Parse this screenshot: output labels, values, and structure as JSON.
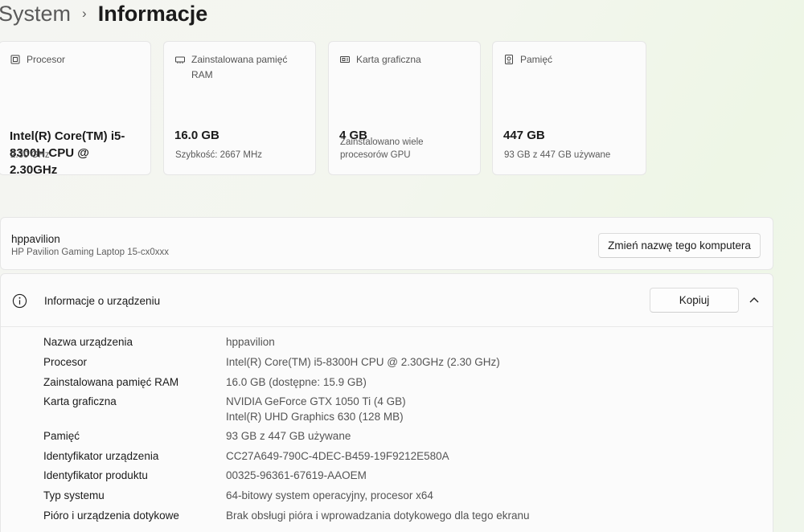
{
  "breadcrumb": {
    "parent": "System",
    "separator": "›",
    "current": "Informacje"
  },
  "cards": [
    {
      "label": "Procesor",
      "value": "Intel(R) Core(TM) i5-8300H CPU @ 2.30GHz",
      "sub": "2.30 GHz",
      "icon": "processor-icon"
    },
    {
      "label": "Zainstalowana pamięć RAM",
      "value": "16.0 GB",
      "sub": "Szybkość: 2667 MHz",
      "icon": "ram-icon"
    },
    {
      "label": "Karta graficzna",
      "value": "4 GB",
      "sub": "Zainstalowano wiele procesorów GPU",
      "icon": "graphics-card-icon"
    },
    {
      "label": "Pamięć",
      "value": "447 GB",
      "sub": "93 GB z 447 GB używane",
      "icon": "storage-icon"
    }
  ],
  "device": {
    "name": "hppavilion",
    "model": "HP Pavilion Gaming Laptop 15-cx0xxx",
    "rename_label": "Zmień nazwę tego komputera"
  },
  "info": {
    "title": "Informacje o urządzeniu",
    "copy_label": "Kopiuj",
    "specs": [
      {
        "key": "Nazwa urządzenia",
        "value": "hppavilion"
      },
      {
        "key": "Procesor",
        "value": "Intel(R) Core(TM) i5-8300H CPU @ 2.30GHz (2.30 GHz)"
      },
      {
        "key": "Zainstalowana pamięć RAM",
        "value": "16.0 GB (dostępne: 15.9 GB)"
      },
      {
        "key": "Karta graficzna",
        "value": "NVIDIA GeForce GTX 1050 Ti (4 GB)",
        "value2": "Intel(R) UHD Graphics 630 (128 MB)"
      },
      {
        "key": "Pamięć",
        "value": "93 GB z 447 GB używane"
      },
      {
        "key": "Identyfikator urządzenia",
        "value": "CC27A649-790C-4DEC-B459-19F9212E580A"
      },
      {
        "key": "Identyfikator produktu",
        "value": "00325-96361-67619-AAOEM"
      },
      {
        "key": "Typ systemu",
        "value": "64-bitowy system operacyjny, procesor x64"
      },
      {
        "key": "Pióro i urządzenia dotykowe",
        "value": "Brak obsługi pióra i wprowadzania dotykowego dla tego ekranu"
      }
    ]
  }
}
